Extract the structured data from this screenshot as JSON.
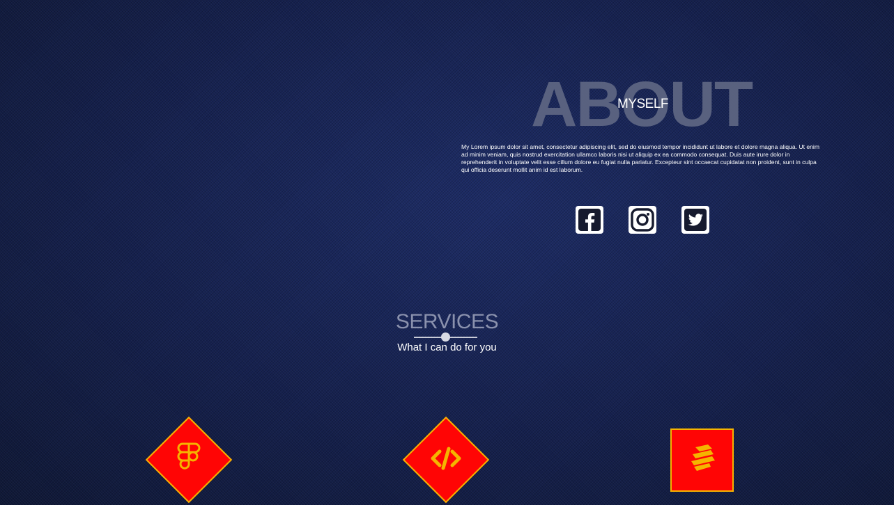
{
  "about": {
    "heading": "ABOUT",
    "subheading": "MYSELF",
    "body": "My Lorem ipsum dolor sit amet, consectetur adipiscing elit, sed do eiusmod tempor incididunt ut labore et dolore magna aliqua. Ut enim ad minim veniam, quis nostrud exercitation ullamco laboris nisi ut aliquip ex ea commodo consequat. Duis aute irure dolor in reprehenderit in voluptate velit esse cillum dolore eu fugiat nulla pariatur. Excepteur sint occaecat cupidatat non proident, sunt in culpa qui officia deserunt mollit anim id est laborum.",
    "social": [
      {
        "icon": "facebook-icon"
      },
      {
        "icon": "instagram-icon"
      },
      {
        "icon": "twitter-icon"
      }
    ]
  },
  "services": {
    "title": "SERVICES",
    "subtitle": "What I can do for you",
    "cards": [
      {
        "icon": "figma-icon"
      },
      {
        "icon": "code-icon"
      },
      {
        "icon": "layers-icon"
      }
    ]
  },
  "colors": {
    "background": "#141f4a",
    "card_fill": "#ff0505",
    "card_border": "#f5b400",
    "card_icon": "#f5b400",
    "about_heading": "#5d6582",
    "services_title": "#8a91ad"
  }
}
